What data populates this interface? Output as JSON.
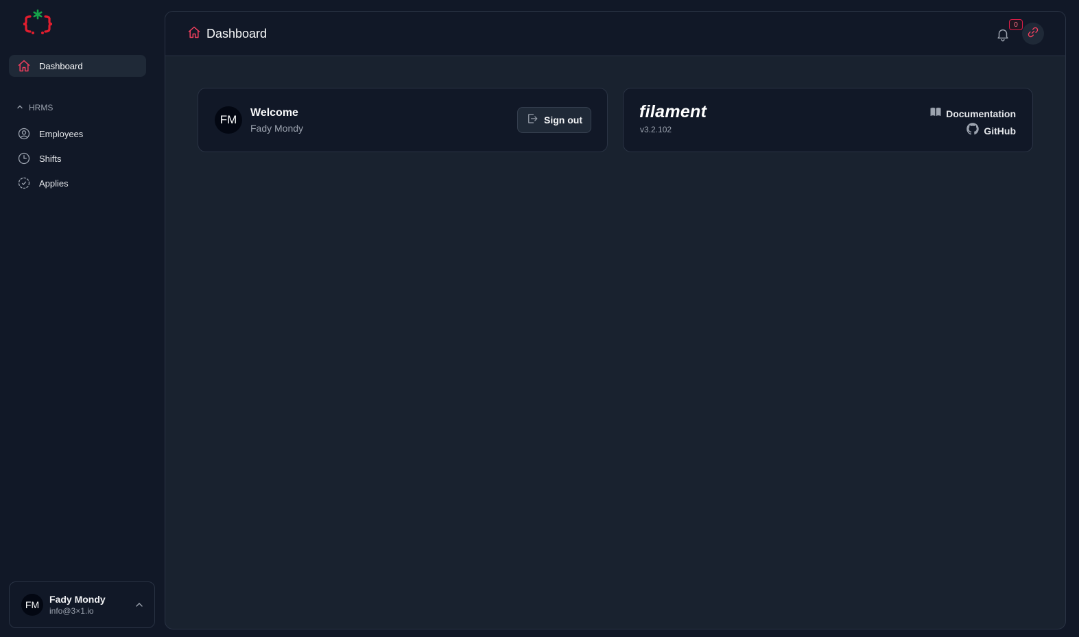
{
  "sidebar": {
    "logo_icon": "brand-logo-icon",
    "items": [
      {
        "label": "Dashboard",
        "icon": "home-icon",
        "active": true
      }
    ],
    "group": {
      "label": "HRMS",
      "icon": "chevron-up-icon",
      "items": [
        {
          "label": "Employees",
          "icon": "user-circle-icon"
        },
        {
          "label": "Shifts",
          "icon": "clock-icon"
        },
        {
          "label": "Applies",
          "icon": "dashed-circle-icon"
        }
      ]
    },
    "user": {
      "initials": "FM",
      "name": "Fady Mondy",
      "email": "info@3×1.io"
    }
  },
  "header": {
    "title": "Dashboard",
    "notifications_count": "0"
  },
  "welcome_card": {
    "initials": "FM",
    "heading": "Welcome",
    "name": "Fady Mondy",
    "sign_out_label": "Sign out"
  },
  "filament_card": {
    "logo_text": "filament",
    "version": "v3.2.102",
    "documentation_label": "Documentation",
    "github_label": "GitHub"
  },
  "colors": {
    "accent": "#f43f5e",
    "background": "#111827",
    "panel": "#19222f",
    "border": "#2a3344"
  }
}
